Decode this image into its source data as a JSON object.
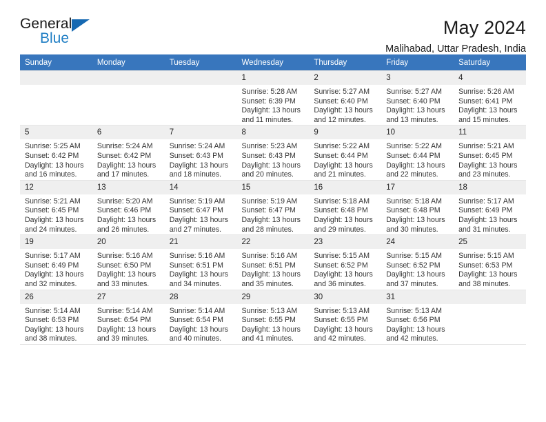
{
  "brand": {
    "name_top": "General",
    "name_bottom": "Blue",
    "triangle_icon": "brand-triangle-icon",
    "accent_color": "#1669b2",
    "blue_text_color": "#1f7ec4"
  },
  "header": {
    "month_title": "May 2024",
    "location": "Malihabad, Uttar Pradesh, India"
  },
  "calendar": {
    "header_bg": "#3876bd",
    "daynum_band_bg": "#efefef",
    "weekdays": [
      "Sunday",
      "Monday",
      "Tuesday",
      "Wednesday",
      "Thursday",
      "Friday",
      "Saturday"
    ],
    "labels": {
      "sunrise_prefix": "Sunrise:",
      "sunset_prefix": "Sunset:",
      "daylight_prefix": "Daylight:"
    },
    "weeks": [
      {
        "shaded": true,
        "days": [
          {
            "num": "",
            "sunrise": "",
            "sunset": "",
            "daylight_line1": "",
            "daylight_line2": ""
          },
          {
            "num": "",
            "sunrise": "",
            "sunset": "",
            "daylight_line1": "",
            "daylight_line2": ""
          },
          {
            "num": "",
            "sunrise": "",
            "sunset": "",
            "daylight_line1": "",
            "daylight_line2": ""
          },
          {
            "num": "1",
            "sunrise": "Sunrise: 5:28 AM",
            "sunset": "Sunset: 6:39 PM",
            "daylight_line1": "Daylight: 13 hours",
            "daylight_line2": "and 11 minutes."
          },
          {
            "num": "2",
            "sunrise": "Sunrise: 5:27 AM",
            "sunset": "Sunset: 6:40 PM",
            "daylight_line1": "Daylight: 13 hours",
            "daylight_line2": "and 12 minutes."
          },
          {
            "num": "3",
            "sunrise": "Sunrise: 5:27 AM",
            "sunset": "Sunset: 6:40 PM",
            "daylight_line1": "Daylight: 13 hours",
            "daylight_line2": "and 13 minutes."
          },
          {
            "num": "4",
            "sunrise": "Sunrise: 5:26 AM",
            "sunset": "Sunset: 6:41 PM",
            "daylight_line1": "Daylight: 13 hours",
            "daylight_line2": "and 15 minutes."
          }
        ]
      },
      {
        "shaded": true,
        "days": [
          {
            "num": "5",
            "sunrise": "Sunrise: 5:25 AM",
            "sunset": "Sunset: 6:42 PM",
            "daylight_line1": "Daylight: 13 hours",
            "daylight_line2": "and 16 minutes."
          },
          {
            "num": "6",
            "sunrise": "Sunrise: 5:24 AM",
            "sunset": "Sunset: 6:42 PM",
            "daylight_line1": "Daylight: 13 hours",
            "daylight_line2": "and 17 minutes."
          },
          {
            "num": "7",
            "sunrise": "Sunrise: 5:24 AM",
            "sunset": "Sunset: 6:43 PM",
            "daylight_line1": "Daylight: 13 hours",
            "daylight_line2": "and 18 minutes."
          },
          {
            "num": "8",
            "sunrise": "Sunrise: 5:23 AM",
            "sunset": "Sunset: 6:43 PM",
            "daylight_line1": "Daylight: 13 hours",
            "daylight_line2": "and 20 minutes."
          },
          {
            "num": "9",
            "sunrise": "Sunrise: 5:22 AM",
            "sunset": "Sunset: 6:44 PM",
            "daylight_line1": "Daylight: 13 hours",
            "daylight_line2": "and 21 minutes."
          },
          {
            "num": "10",
            "sunrise": "Sunrise: 5:22 AM",
            "sunset": "Sunset: 6:44 PM",
            "daylight_line1": "Daylight: 13 hours",
            "daylight_line2": "and 22 minutes."
          },
          {
            "num": "11",
            "sunrise": "Sunrise: 5:21 AM",
            "sunset": "Sunset: 6:45 PM",
            "daylight_line1": "Daylight: 13 hours",
            "daylight_line2": "and 23 minutes."
          }
        ]
      },
      {
        "shaded": true,
        "days": [
          {
            "num": "12",
            "sunrise": "Sunrise: 5:21 AM",
            "sunset": "Sunset: 6:45 PM",
            "daylight_line1": "Daylight: 13 hours",
            "daylight_line2": "and 24 minutes."
          },
          {
            "num": "13",
            "sunrise": "Sunrise: 5:20 AM",
            "sunset": "Sunset: 6:46 PM",
            "daylight_line1": "Daylight: 13 hours",
            "daylight_line2": "and 26 minutes."
          },
          {
            "num": "14",
            "sunrise": "Sunrise: 5:19 AM",
            "sunset": "Sunset: 6:47 PM",
            "daylight_line1": "Daylight: 13 hours",
            "daylight_line2": "and 27 minutes."
          },
          {
            "num": "15",
            "sunrise": "Sunrise: 5:19 AM",
            "sunset": "Sunset: 6:47 PM",
            "daylight_line1": "Daylight: 13 hours",
            "daylight_line2": "and 28 minutes."
          },
          {
            "num": "16",
            "sunrise": "Sunrise: 5:18 AM",
            "sunset": "Sunset: 6:48 PM",
            "daylight_line1": "Daylight: 13 hours",
            "daylight_line2": "and 29 minutes."
          },
          {
            "num": "17",
            "sunrise": "Sunrise: 5:18 AM",
            "sunset": "Sunset: 6:48 PM",
            "daylight_line1": "Daylight: 13 hours",
            "daylight_line2": "and 30 minutes."
          },
          {
            "num": "18",
            "sunrise": "Sunrise: 5:17 AM",
            "sunset": "Sunset: 6:49 PM",
            "daylight_line1": "Daylight: 13 hours",
            "daylight_line2": "and 31 minutes."
          }
        ]
      },
      {
        "shaded": true,
        "days": [
          {
            "num": "19",
            "sunrise": "Sunrise: 5:17 AM",
            "sunset": "Sunset: 6:49 PM",
            "daylight_line1": "Daylight: 13 hours",
            "daylight_line2": "and 32 minutes."
          },
          {
            "num": "20",
            "sunrise": "Sunrise: 5:16 AM",
            "sunset": "Sunset: 6:50 PM",
            "daylight_line1": "Daylight: 13 hours",
            "daylight_line2": "and 33 minutes."
          },
          {
            "num": "21",
            "sunrise": "Sunrise: 5:16 AM",
            "sunset": "Sunset: 6:51 PM",
            "daylight_line1": "Daylight: 13 hours",
            "daylight_line2": "and 34 minutes."
          },
          {
            "num": "22",
            "sunrise": "Sunrise: 5:16 AM",
            "sunset": "Sunset: 6:51 PM",
            "daylight_line1": "Daylight: 13 hours",
            "daylight_line2": "and 35 minutes."
          },
          {
            "num": "23",
            "sunrise": "Sunrise: 5:15 AM",
            "sunset": "Sunset: 6:52 PM",
            "daylight_line1": "Daylight: 13 hours",
            "daylight_line2": "and 36 minutes."
          },
          {
            "num": "24",
            "sunrise": "Sunrise: 5:15 AM",
            "sunset": "Sunset: 6:52 PM",
            "daylight_line1": "Daylight: 13 hours",
            "daylight_line2": "and 37 minutes."
          },
          {
            "num": "25",
            "sunrise": "Sunrise: 5:15 AM",
            "sunset": "Sunset: 6:53 PM",
            "daylight_line1": "Daylight: 13 hours",
            "daylight_line2": "and 38 minutes."
          }
        ]
      },
      {
        "shaded": true,
        "days": [
          {
            "num": "26",
            "sunrise": "Sunrise: 5:14 AM",
            "sunset": "Sunset: 6:53 PM",
            "daylight_line1": "Daylight: 13 hours",
            "daylight_line2": "and 38 minutes."
          },
          {
            "num": "27",
            "sunrise": "Sunrise: 5:14 AM",
            "sunset": "Sunset: 6:54 PM",
            "daylight_line1": "Daylight: 13 hours",
            "daylight_line2": "and 39 minutes."
          },
          {
            "num": "28",
            "sunrise": "Sunrise: 5:14 AM",
            "sunset": "Sunset: 6:54 PM",
            "daylight_line1": "Daylight: 13 hours",
            "daylight_line2": "and 40 minutes."
          },
          {
            "num": "29",
            "sunrise": "Sunrise: 5:13 AM",
            "sunset": "Sunset: 6:55 PM",
            "daylight_line1": "Daylight: 13 hours",
            "daylight_line2": "and 41 minutes."
          },
          {
            "num": "30",
            "sunrise": "Sunrise: 5:13 AM",
            "sunset": "Sunset: 6:55 PM",
            "daylight_line1": "Daylight: 13 hours",
            "daylight_line2": "and 42 minutes."
          },
          {
            "num": "31",
            "sunrise": "Sunrise: 5:13 AM",
            "sunset": "Sunset: 6:56 PM",
            "daylight_line1": "Daylight: 13 hours",
            "daylight_line2": "and 42 minutes."
          },
          {
            "num": "",
            "sunrise": "",
            "sunset": "",
            "daylight_line1": "",
            "daylight_line2": ""
          }
        ]
      }
    ]
  }
}
